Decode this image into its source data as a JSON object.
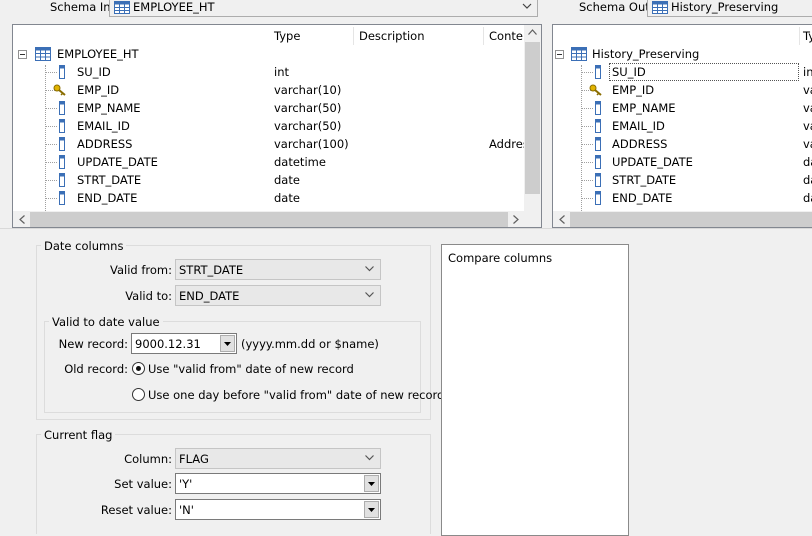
{
  "schema_in": {
    "label": "Schema In:",
    "value": "EMPLOYEE_HT",
    "columns": [
      "Type",
      "Description",
      "Conter"
    ],
    "root": "EMPLOYEE_HT",
    "fields": [
      {
        "name": "SU_ID",
        "type": "int",
        "content": "",
        "icon": "column-icon"
      },
      {
        "name": "EMP_ID",
        "type": "varchar(10)",
        "content": "",
        "icon": "key-icon"
      },
      {
        "name": "EMP_NAME",
        "type": "varchar(50)",
        "content": "",
        "icon": "column-icon"
      },
      {
        "name": "EMAIL_ID",
        "type": "varchar(50)",
        "content": "",
        "icon": "column-icon"
      },
      {
        "name": "ADDRESS",
        "type": "varchar(100)",
        "content": "Addres",
        "icon": "column-icon"
      },
      {
        "name": "UPDATE_DATE",
        "type": "datetime",
        "content": "",
        "icon": "column-icon"
      },
      {
        "name": "STRT_DATE",
        "type": "date",
        "content": "",
        "icon": "column-icon"
      },
      {
        "name": "END_DATE",
        "type": "date",
        "content": "",
        "icon": "column-icon"
      }
    ]
  },
  "schema_out": {
    "label": "Schema Out:",
    "value": "History_Preserving",
    "columns": [
      "Ty"
    ],
    "root": "History_Preserving",
    "fields": [
      {
        "name": "SU_ID",
        "type": "in",
        "icon": "column-icon",
        "selected": true
      },
      {
        "name": "EMP_ID",
        "type": "va",
        "icon": "key-icon"
      },
      {
        "name": "EMP_NAME",
        "type": "va",
        "icon": "column-icon"
      },
      {
        "name": "EMAIL_ID",
        "type": "va",
        "icon": "column-icon"
      },
      {
        "name": "ADDRESS",
        "type": "va",
        "icon": "column-icon"
      },
      {
        "name": "UPDATE_DATE",
        "type": "da",
        "icon": "column-icon"
      },
      {
        "name": "STRT_DATE",
        "type": "da",
        "icon": "column-icon"
      },
      {
        "name": "END_DATE",
        "type": "da",
        "icon": "column-icon"
      }
    ]
  },
  "date_columns": {
    "title": "Date columns",
    "valid_from_label": "Valid from:",
    "valid_from": "STRT_DATE",
    "valid_to_label": "Valid to:",
    "valid_to": "END_DATE",
    "valid_to_value": {
      "title": "Valid to date value",
      "new_record_label": "New record:",
      "new_record": "9000.12.31",
      "new_record_hint": "(yyyy.mm.dd or $name)",
      "old_record_label": "Old record:",
      "option_1": "Use \"valid from\" date of new record",
      "option_2": "Use one day before \"valid from\" date of new record",
      "selected_option": 1
    }
  },
  "current_flag": {
    "title": "Current flag",
    "column_label": "Column:",
    "column": "FLAG",
    "set_value_label": "Set value:",
    "set_value": "'Y'",
    "reset_value_label": "Reset value:",
    "reset_value": "'N'"
  },
  "compare_columns": {
    "title": "Compare columns"
  }
}
